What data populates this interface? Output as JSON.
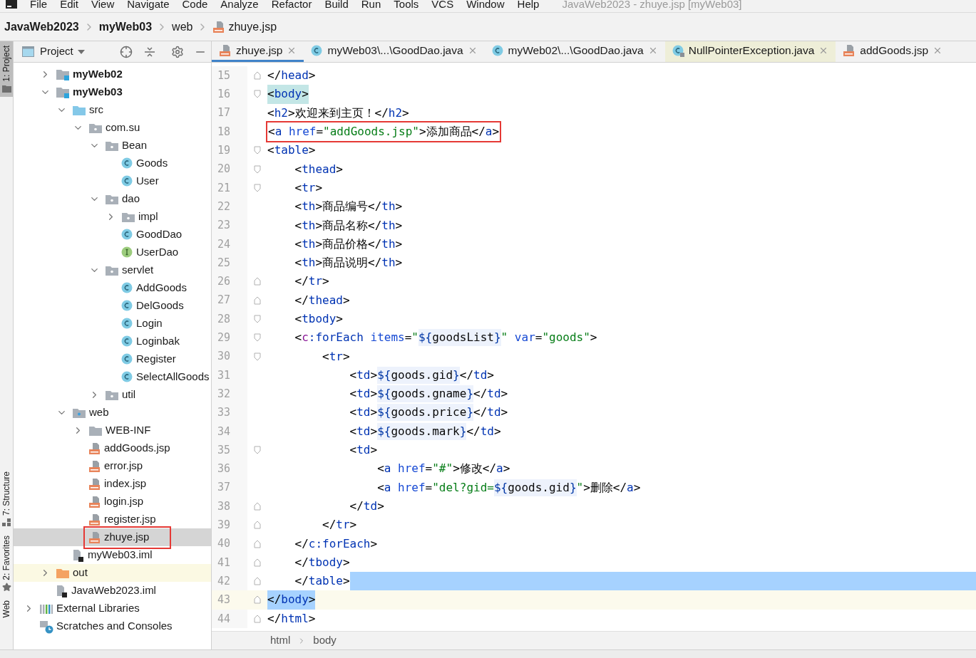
{
  "menu": [
    "File",
    "Edit",
    "View",
    "Navigate",
    "Code",
    "Analyze",
    "Refactor",
    "Build",
    "Run",
    "Tools",
    "VCS",
    "Window",
    "Help"
  ],
  "window": {
    "title": "JavaWeb2023 - zhuye.jsp [myWeb03]"
  },
  "breadcrumbs": [
    {
      "label": "JavaWeb2023",
      "bold": true,
      "kind": "project"
    },
    {
      "label": "myWeb03",
      "bold": true,
      "kind": "module"
    },
    {
      "label": "web",
      "bold": false,
      "kind": "folder"
    },
    {
      "label": "zhuye.jsp",
      "bold": false,
      "kind": "jsp"
    }
  ],
  "tool_strip": [
    {
      "label": "1: Project",
      "selected": true,
      "kind": "project"
    },
    {
      "label": "7: Structure",
      "selected": false,
      "kind": "structure"
    },
    {
      "label": "2: Favorites",
      "selected": false,
      "kind": "favorites"
    },
    {
      "label": "Web",
      "selected": false,
      "kind": "web"
    }
  ],
  "project_panel": {
    "title": "Project"
  },
  "tree": [
    {
      "children": [
        {
          "label": "myWeb02",
          "kind": "module",
          "bold": true,
          "expanded": false,
          "selected": false,
          "boxed": false
        },
        {
          "label": "myWeb03",
          "kind": "module",
          "bold": true,
          "expanded": true,
          "selected": false,
          "boxed": false,
          "children": [
            {
              "label": "src",
              "kind": "source-folder",
              "bold": false,
              "expanded": true,
              "selected": false,
              "boxed": false,
              "children": [
                {
                  "label": "com.su",
                  "kind": "package",
                  "bold": false,
                  "expanded": true,
                  "selected": false,
                  "boxed": false,
                  "children": [
                    {
                      "label": "Bean",
                      "kind": "package",
                      "bold": false,
                      "expanded": true,
                      "selected": false,
                      "boxed": false,
                      "children": [
                        {
                          "label": "Goods",
                          "kind": "class",
                          "bold": false,
                          "selected": false,
                          "boxed": false
                        },
                        {
                          "label": "User",
                          "kind": "class",
                          "bold": false,
                          "selected": false,
                          "boxed": false
                        }
                      ]
                    },
                    {
                      "label": "dao",
                      "kind": "package",
                      "bold": false,
                      "expanded": true,
                      "selected": false,
                      "boxed": false,
                      "children": [
                        {
                          "label": "impl",
                          "kind": "package",
                          "bold": false,
                          "expanded": false,
                          "selected": false,
                          "boxed": false
                        },
                        {
                          "label": "GoodDao",
                          "kind": "class",
                          "bold": false,
                          "selected": false,
                          "boxed": false
                        },
                        {
                          "label": "UserDao",
                          "kind": "interface",
                          "bold": false,
                          "selected": false,
                          "boxed": false
                        }
                      ]
                    },
                    {
                      "label": "servlet",
                      "kind": "package",
                      "bold": false,
                      "expanded": true,
                      "selected": false,
                      "boxed": false,
                      "children": [
                        {
                          "label": "AddGoods",
                          "kind": "class",
                          "bold": false,
                          "selected": false,
                          "boxed": false
                        },
                        {
                          "label": "DelGoods",
                          "kind": "class",
                          "bold": false,
                          "selected": false,
                          "boxed": false
                        },
                        {
                          "label": "Login",
                          "kind": "class",
                          "bold": false,
                          "selected": false,
                          "boxed": false
                        },
                        {
                          "label": "Loginbak",
                          "kind": "class",
                          "bold": false,
                          "selected": false,
                          "boxed": false
                        },
                        {
                          "label": "Register",
                          "kind": "class",
                          "bold": false,
                          "selected": false,
                          "boxed": false
                        },
                        {
                          "label": "SelectAllGoods",
                          "kind": "class",
                          "bold": false,
                          "selected": false,
                          "boxed": false
                        }
                      ]
                    },
                    {
                      "label": "util",
                      "kind": "package",
                      "bold": false,
                      "expanded": false,
                      "selected": false,
                      "boxed": false
                    }
                  ]
                }
              ]
            },
            {
              "label": "web",
              "kind": "web-folder",
              "bold": false,
              "expanded": true,
              "selected": false,
              "boxed": false,
              "children": [
                {
                  "label": "WEB-INF",
                  "kind": "folder",
                  "bold": false,
                  "expanded": false,
                  "selected": false,
                  "boxed": false
                },
                {
                  "label": "addGoods.jsp",
                  "kind": "jsp",
                  "bold": false,
                  "selected": false,
                  "boxed": false
                },
                {
                  "label": "error.jsp",
                  "kind": "jsp",
                  "bold": false,
                  "selected": false,
                  "boxed": false
                },
                {
                  "label": "index.jsp",
                  "kind": "jsp",
                  "bold": false,
                  "selected": false,
                  "boxed": false
                },
                {
                  "label": "login.jsp",
                  "kind": "jsp",
                  "bold": false,
                  "selected": false,
                  "boxed": false
                },
                {
                  "label": "register.jsp",
                  "kind": "jsp",
                  "bold": false,
                  "selected": false,
                  "boxed": false
                },
                {
                  "label": "zhuye.jsp",
                  "kind": "jsp",
                  "bold": false,
                  "selected": true,
                  "boxed": true
                }
              ]
            },
            {
              "label": "myWeb03.iml",
              "kind": "iml",
              "bold": false,
              "selected": false,
              "boxed": false
            }
          ]
        },
        {
          "label": "out",
          "kind": "excluded-folder",
          "bold": false,
          "expanded": false,
          "selected": false,
          "boxed": false
        },
        {
          "label": "JavaWeb2023.iml",
          "kind": "iml",
          "bold": false,
          "selected": false,
          "boxed": false
        }
      ]
    },
    {
      "label": "External Libraries",
      "kind": "libraries",
      "bold": false,
      "expanded": false,
      "selected": false,
      "boxed": false
    },
    {
      "label": "Scratches and Consoles",
      "kind": "scratches",
      "bold": false,
      "selected": false,
      "boxed": false
    }
  ],
  "tabs": [
    {
      "label": "zhuye.jsp",
      "selected": true,
      "kind": "jsp"
    },
    {
      "label": "myWeb03\\...\\GoodDao.java",
      "selected": false,
      "kind": "class"
    },
    {
      "label": "myWeb02\\...\\GoodDao.java",
      "selected": false,
      "kind": "class"
    },
    {
      "label": "NullPointerException.java",
      "selected": false,
      "kind": "library-class"
    },
    {
      "label": "addGoods.jsp",
      "selected": false,
      "kind": "jsp"
    }
  ],
  "code_lines": [
    {
      "number": "15",
      "fold_start": false,
      "fold_end": true,
      "text": "</head>",
      "match": false,
      "boxed": false,
      "selected": false,
      "selection_tail": false
    },
    {
      "number": "16",
      "fold_start": true,
      "fold_end": false,
      "text": "<body>",
      "match": true,
      "boxed": false,
      "selected": false,
      "selection_tail": false
    },
    {
      "number": "17",
      "fold_start": false,
      "fold_end": false,
      "text": "<h2>欢迎来到主页！</h2>",
      "match": false,
      "boxed": false,
      "selected": false,
      "selection_tail": false
    },
    {
      "number": "18",
      "fold_start": false,
      "fold_end": false,
      "text": "<a href=\"addGoods.jsp\">添加商品</a>",
      "match": false,
      "boxed": true,
      "selected": false,
      "selection_tail": false
    },
    {
      "number": "19",
      "fold_start": true,
      "fold_end": false,
      "text": "<table>",
      "match": false,
      "boxed": false,
      "selected": false,
      "selection_tail": false
    },
    {
      "number": "20",
      "fold_start": true,
      "fold_end": false,
      "text": "    <thead>",
      "match": false,
      "boxed": false,
      "selected": false,
      "selection_tail": false
    },
    {
      "number": "21",
      "fold_start": true,
      "fold_end": false,
      "text": "    <tr>",
      "match": false,
      "boxed": false,
      "selected": false,
      "selection_tail": false
    },
    {
      "number": "22",
      "fold_start": false,
      "fold_end": false,
      "text": "    <th>商品编号</th>",
      "match": false,
      "boxed": false,
      "selected": false,
      "selection_tail": false
    },
    {
      "number": "23",
      "fold_start": false,
      "fold_end": false,
      "text": "    <th>商品名称</th>",
      "match": false,
      "boxed": false,
      "selected": false,
      "selection_tail": false
    },
    {
      "number": "24",
      "fold_start": false,
      "fold_end": false,
      "text": "    <th>商品价格</th>",
      "match": false,
      "boxed": false,
      "selected": false,
      "selection_tail": false
    },
    {
      "number": "25",
      "fold_start": false,
      "fold_end": false,
      "text": "    <th>商品说明</th>",
      "match": false,
      "boxed": false,
      "selected": false,
      "selection_tail": false
    },
    {
      "number": "26",
      "fold_start": false,
      "fold_end": true,
      "text": "    </tr>",
      "match": false,
      "boxed": false,
      "selected": false,
      "selection_tail": false
    },
    {
      "number": "27",
      "fold_start": false,
      "fold_end": true,
      "text": "    </thead>",
      "match": false,
      "boxed": false,
      "selected": false,
      "selection_tail": false
    },
    {
      "number": "28",
      "fold_start": true,
      "fold_end": false,
      "text": "    <tbody>",
      "match": false,
      "boxed": false,
      "selected": false,
      "selection_tail": false
    },
    {
      "number": "29",
      "fold_start": true,
      "fold_end": false,
      "text": "    <c:forEach items=\"${goodsList}\" var=\"goods\">",
      "match": false,
      "boxed": false,
      "selected": false,
      "selection_tail": false
    },
    {
      "number": "30",
      "fold_start": true,
      "fold_end": false,
      "text": "        <tr>",
      "match": false,
      "boxed": false,
      "selected": false,
      "selection_tail": false
    },
    {
      "number": "31",
      "fold_start": false,
      "fold_end": false,
      "text": "            <td>${goods.gid}</td>",
      "match": false,
      "boxed": false,
      "selected": false,
      "selection_tail": false
    },
    {
      "number": "32",
      "fold_start": false,
      "fold_end": false,
      "text": "            <td>${goods.gname}</td>",
      "match": false,
      "boxed": false,
      "selected": false,
      "selection_tail": false
    },
    {
      "number": "33",
      "fold_start": false,
      "fold_end": false,
      "text": "            <td>${goods.price}</td>",
      "match": false,
      "boxed": false,
      "selected": false,
      "selection_tail": false
    },
    {
      "number": "34",
      "fold_start": false,
      "fold_end": false,
      "text": "            <td>${goods.mark}</td>",
      "match": false,
      "boxed": false,
      "selected": false,
      "selection_tail": false
    },
    {
      "number": "35",
      "fold_start": true,
      "fold_end": false,
      "text": "            <td>",
      "match": false,
      "boxed": false,
      "selected": false,
      "selection_tail": false
    },
    {
      "number": "36",
      "fold_start": false,
      "fold_end": false,
      "text": "                <a href=\"#\">修改</a>",
      "match": false,
      "boxed": false,
      "selected": false,
      "selection_tail": false
    },
    {
      "number": "37",
      "fold_start": false,
      "fold_end": false,
      "text": "                <a href=\"del?gid=${goods.gid}\">删除</a>",
      "match": false,
      "boxed": false,
      "selected": false,
      "selection_tail": false
    },
    {
      "number": "38",
      "fold_start": false,
      "fold_end": true,
      "text": "            </td>",
      "match": false,
      "boxed": false,
      "selected": false,
      "selection_tail": false
    },
    {
      "number": "39",
      "fold_start": false,
      "fold_end": true,
      "text": "        </tr>",
      "match": false,
      "boxed": false,
      "selected": false,
      "selection_tail": false
    },
    {
      "number": "40",
      "fold_start": false,
      "fold_end": true,
      "text": "    </c:forEach>",
      "match": false,
      "boxed": false,
      "selected": false,
      "selection_tail": false
    },
    {
      "number": "41",
      "fold_start": false,
      "fold_end": true,
      "text": "    </tbody>",
      "match": false,
      "boxed": false,
      "selected": false,
      "selection_tail": false
    },
    {
      "number": "42",
      "fold_start": false,
      "fold_end": true,
      "text": "    </table>",
      "match": false,
      "boxed": false,
      "selected": false,
      "selection_tail": true
    },
    {
      "number": "43",
      "fold_start": false,
      "fold_end": true,
      "text": "</body>",
      "match": false,
      "boxed": false,
      "selected": true,
      "selection_tail": false
    },
    {
      "number": "44",
      "fold_start": false,
      "fold_end": true,
      "text": "</html>",
      "match": false,
      "boxed": false,
      "selected": false,
      "selection_tail": false
    }
  ],
  "editor_breadcrumbs": [
    "html",
    "body"
  ]
}
